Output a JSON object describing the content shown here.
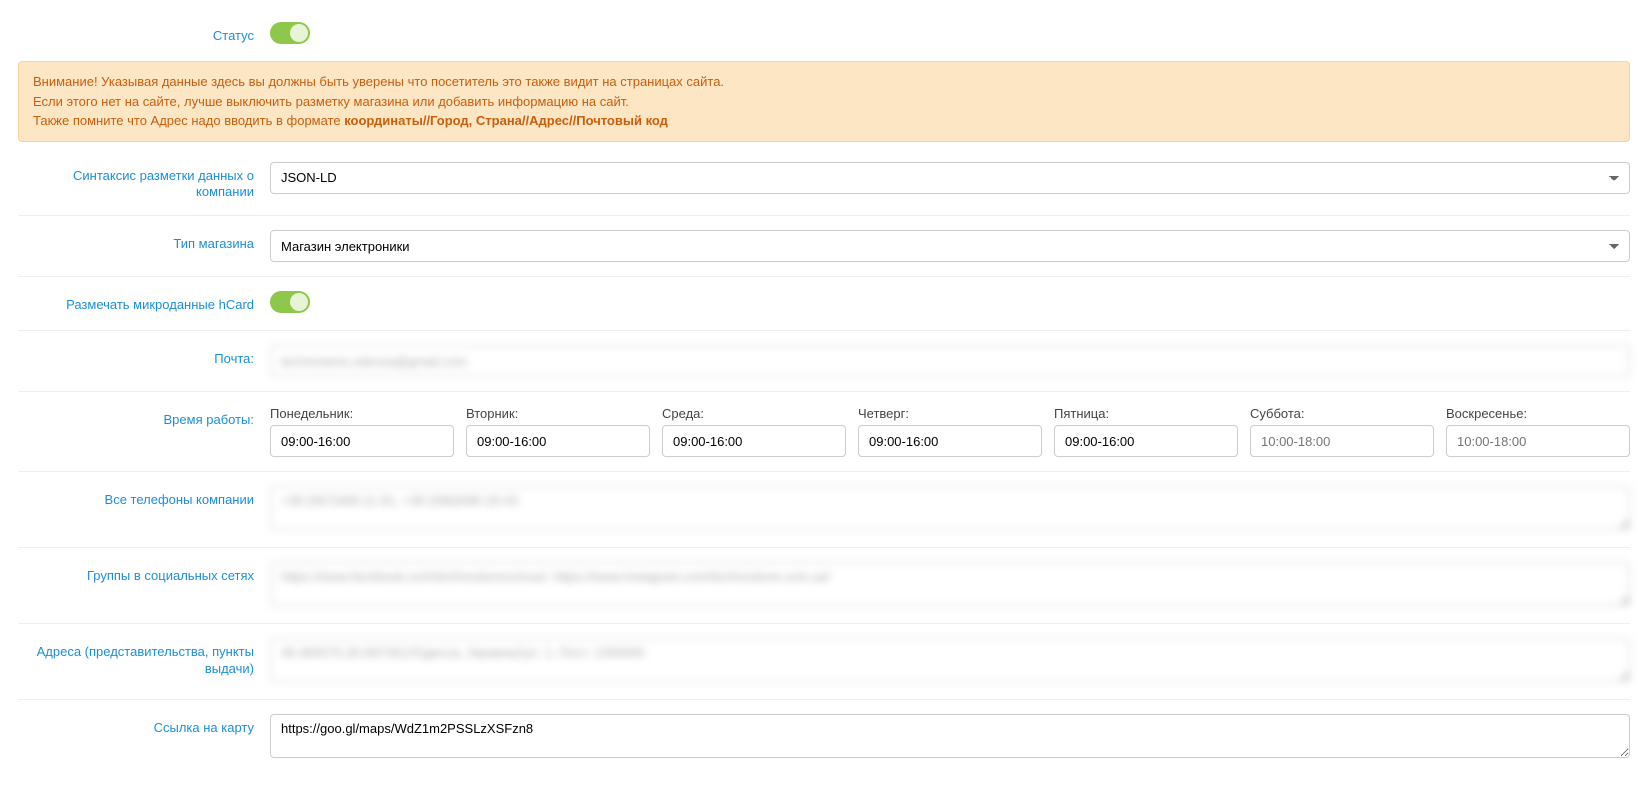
{
  "labels": {
    "status": "Статус",
    "syntax": "Синтаксис разметки данных о компании",
    "store_type": "Тип магазина",
    "hcard": "Размечать микроданные hCard",
    "email": "Почта:",
    "hours": "Время работы:",
    "phones": "Все телефоны компании",
    "social": "Группы в социальных сетях",
    "addresses": "Адреса (представительства, пункты выдачи)",
    "map_link": "Ссылка на карту"
  },
  "alert": {
    "line1": "Внимание! Указывая данные здесь вы должны быть уверены что посетитель это также видит на страницах сайта.",
    "line2": "Если этого нет на сайте, лучше выключить разметку магазина или добавить информацию на сайт.",
    "line3_pre": "Также помните что Адрес надо вводить в формате ",
    "line3_bold": "координаты//Город, Страна//Адрес//Почтовый код"
  },
  "fields": {
    "syntax_value": "JSON-LD",
    "store_type_value": "Магазин электроники",
    "email_value": "technostore.odessa@gmail.com",
    "phones_value": "+38 (067)408-11-91, +38 (096)098-18-43",
    "social_value": "https://www.facebook.com/technostorecomua/, https://www.instagram.com/technostore.com.ua/",
    "addresses_value": "46.484575,30.687261//Одесса, Украина//ул. 1. Пост. 1//65000",
    "map_link_value": "https://goo.gl/maps/WdZ1m2PSSLzXSFzn8"
  },
  "days": [
    {
      "label": "Понедельник:",
      "value": "09:00-16:00"
    },
    {
      "label": "Вторник:",
      "value": "09:00-16:00"
    },
    {
      "label": "Среда:",
      "value": "09:00-16:00"
    },
    {
      "label": "Четверг:",
      "value": "09:00-16:00"
    },
    {
      "label": "Пятница:",
      "value": "09:00-16:00"
    },
    {
      "label": "Суббота:",
      "value": "",
      "placeholder": "10:00-18:00"
    },
    {
      "label": "Воскресенье:",
      "value": "",
      "placeholder": "10:00-18:00"
    }
  ],
  "toggles": {
    "status": true,
    "hcard": true
  }
}
